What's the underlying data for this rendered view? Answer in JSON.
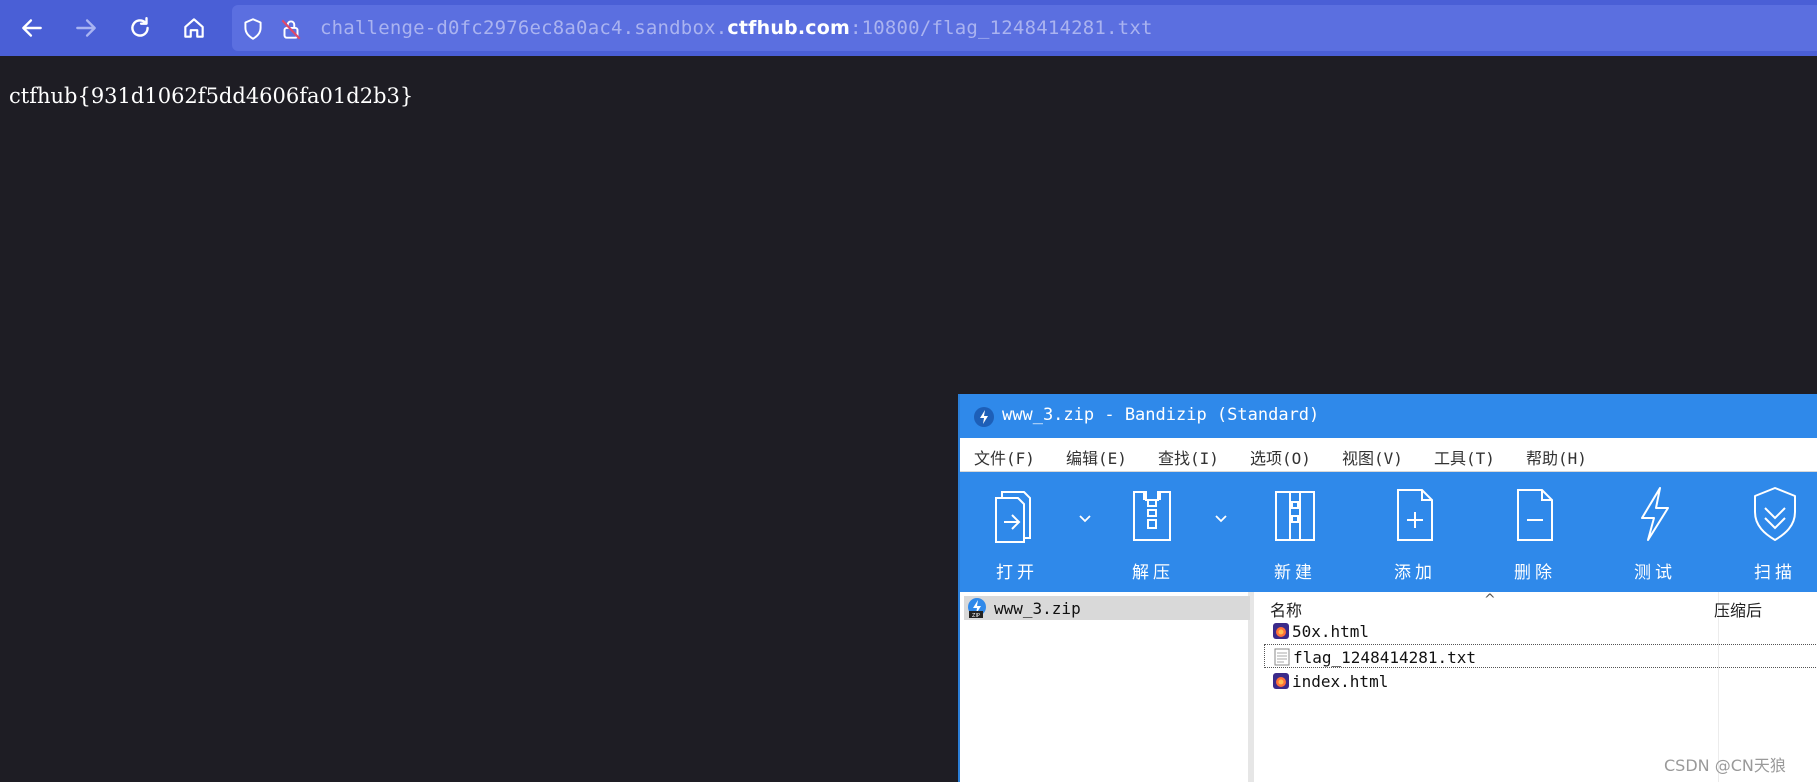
{
  "browser": {
    "url_prefix": "challenge-d0fc2976ec8a0ac4.sandbox.",
    "url_domain": "ctfhub.com",
    "url_suffix": ":10800/flag_1248414281.txt"
  },
  "page": {
    "content": "ctfhub{931d1062f5dd4606fa01d2b3}"
  },
  "bandizip": {
    "title": "www_3.zip - Bandizip (Standard)",
    "menu": [
      "文件(F)",
      "编辑(E)",
      "查找(I)",
      "选项(O)",
      "视图(V)",
      "工具(T)",
      "帮助(H)"
    ],
    "tools": [
      "打开",
      "解压",
      "新建",
      "添加",
      "删除",
      "测试",
      "扫描"
    ],
    "tree_item": "www_3.zip",
    "columns": {
      "name": "名称",
      "compressed": "压缩后"
    },
    "files": [
      {
        "name": "50x.html",
        "icon": "html-file-icon"
      },
      {
        "name": "flag_1248414281.txt",
        "icon": "text-file-icon"
      },
      {
        "name": "index.html",
        "icon": "html-file-icon"
      }
    ]
  },
  "watermark": "CSDN @CN天狼",
  "colors": {
    "toolbar": "#4a5fd6",
    "page_bg": "#1e1d24",
    "bandizip_blue": "#2f89ea"
  }
}
